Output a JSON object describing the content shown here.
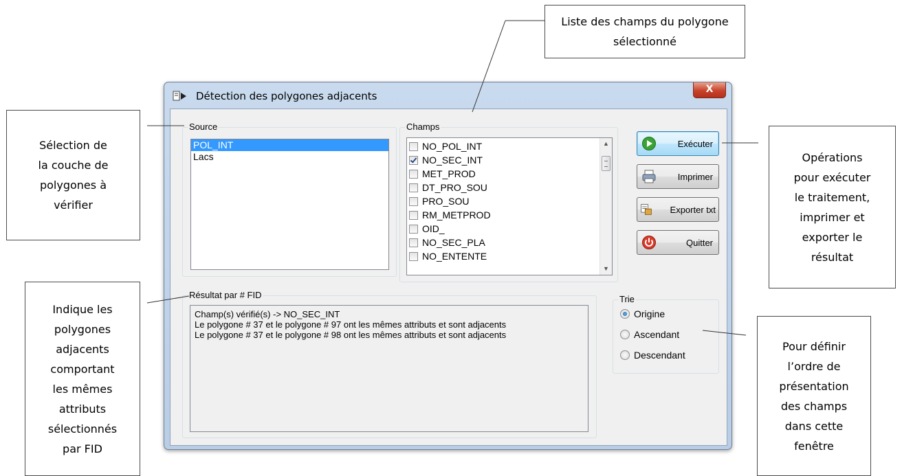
{
  "window": {
    "title": "Détection des polygones adjacents",
    "close_label": "X"
  },
  "source": {
    "label": "Source",
    "items": [
      {
        "label": "POL_INT",
        "selected": true
      },
      {
        "label": "Lacs",
        "selected": false
      }
    ]
  },
  "champs": {
    "label": "Champs",
    "items": [
      {
        "label": "NO_POL_INT",
        "checked": false
      },
      {
        "label": "NO_SEC_INT",
        "checked": true
      },
      {
        "label": "MET_PROD",
        "checked": false
      },
      {
        "label": "DT_PRO_SOU",
        "checked": false
      },
      {
        "label": "PRO_SOU",
        "checked": false
      },
      {
        "label": "RM_METPROD",
        "checked": false
      },
      {
        "label": "OID_",
        "checked": false
      },
      {
        "label": "NO_SEC_PLA",
        "checked": false
      },
      {
        "label": "NO_ENTENTE",
        "checked": false
      }
    ]
  },
  "buttons": {
    "executer": "Exécuter",
    "imprimer": "Imprimer",
    "exporter": "Exporter txt",
    "quitter": "Quitter"
  },
  "result": {
    "label": "Résultat par # FID",
    "lines": [
      "Champ(s) vérifié(s) -> NO_SEC_INT",
      "Le polygone # 37 et le polygone # 97 ont les mêmes attributs et sont adjacents",
      "Le polygone # 37 et le polygone # 98 ont les mêmes attributs et sont adjacents"
    ]
  },
  "trie": {
    "label": "Trie",
    "options": [
      {
        "label": "Origine",
        "selected": true
      },
      {
        "label": "Ascendant",
        "selected": false
      },
      {
        "label": "Descendant",
        "selected": false
      }
    ]
  },
  "callouts": {
    "champs_list": "Liste des champs du polygone\nsélectionné",
    "source_selection": "Sélection de\nla couche de\npolygones à\nvérifier",
    "operations": "Opérations\npour exécuter\nle traitement,\nimprimer  et\nexporter le\nrésultat",
    "result_info": "Indique les\npolygones\nadjacents\ncomportant\nles mêmes\nattributs\nsélectionnés\npar FID",
    "sort_info": "Pour définir\nl’ordre de\nprésentation\ndes champs\ndans cette\nfenêtre"
  }
}
